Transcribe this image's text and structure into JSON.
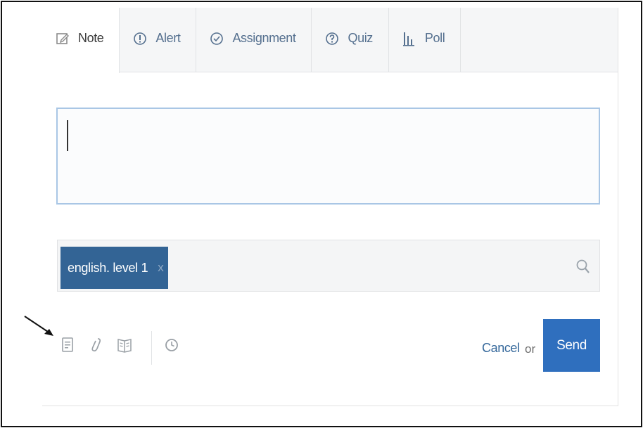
{
  "tabs": [
    {
      "label": "Note",
      "icon": "note-icon",
      "active": true
    },
    {
      "label": "Alert",
      "icon": "alert-icon",
      "active": false
    },
    {
      "label": "Assignment",
      "icon": "assignment-icon",
      "active": false
    },
    {
      "label": "Quiz",
      "icon": "quiz-icon",
      "active": false
    },
    {
      "label": "Poll",
      "icon": "poll-icon",
      "active": false
    }
  ],
  "note": {
    "value": ""
  },
  "recipients": {
    "chips": [
      {
        "label": "english. level 1",
        "remove_label": "x"
      }
    ],
    "search_icon": "search-icon"
  },
  "toolbar": {
    "icons": [
      "file-icon",
      "link-icon",
      "library-icon",
      "schedule-icon"
    ],
    "cancel_label": "Cancel",
    "or_label": "or",
    "send_label": "Send"
  },
  "colors": {
    "accent": "#2f6fbe",
    "chip": "#336495",
    "link": "#35689b"
  }
}
